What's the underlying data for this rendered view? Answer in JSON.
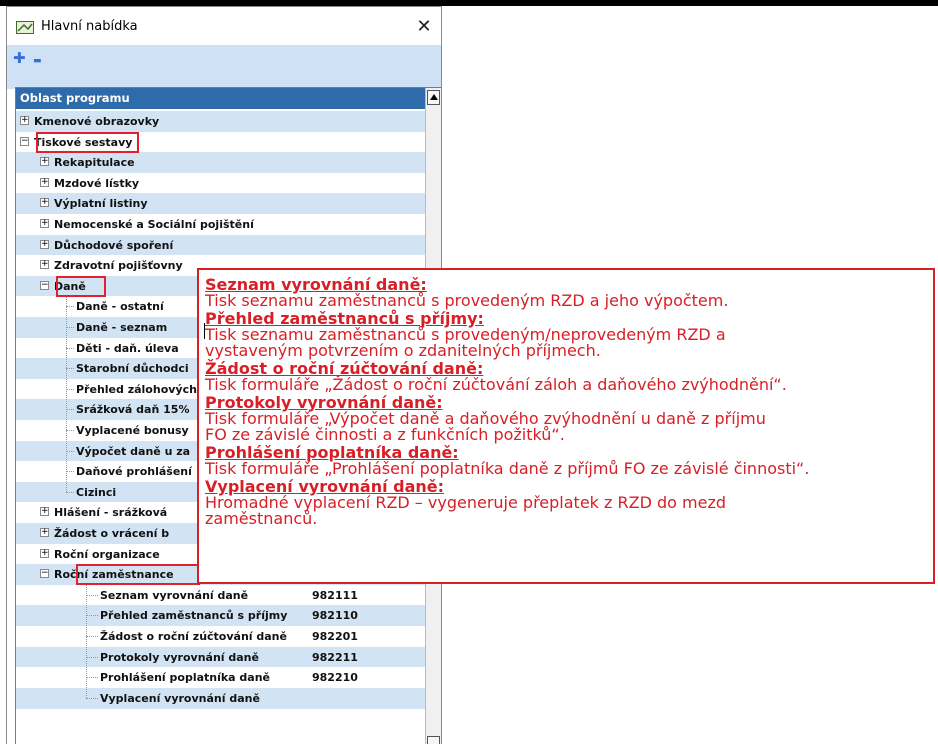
{
  "window": {
    "title": "Hlavní nabídka",
    "close_glyph": "✕",
    "toolbar": {
      "add_glyph": "✚",
      "remove_glyph": "▬"
    }
  },
  "tree": {
    "column_header": "Oblast programu",
    "rows": [
      {
        "label": "Kmenové obrazovky",
        "expander": "+"
      },
      {
        "label": "Tiskové sestavy",
        "expander": "−"
      },
      {
        "label": "Rekapitulace",
        "expander": "+"
      },
      {
        "label": "Mzdové lístky",
        "expander": "+"
      },
      {
        "label": "Výplatní listiny",
        "expander": "+"
      },
      {
        "label": "Nemocenské a Sociální pojištění",
        "expander": "+"
      },
      {
        "label": "Důchodové spoření",
        "expander": "+"
      },
      {
        "label": "Zdravotní pojišťovny",
        "expander": "+"
      },
      {
        "label": "Daně",
        "expander": "−"
      },
      {
        "label": "Daně - ostatní"
      },
      {
        "label": "Daně - seznam"
      },
      {
        "label": "Děti - daň. úleva"
      },
      {
        "label": "Starobní důchodci"
      },
      {
        "label": "Přehled zálohových"
      },
      {
        "label": "Srážková daň 15%"
      },
      {
        "label": "Vyplacené bonusy"
      },
      {
        "label": "Výpočet daně u za"
      },
      {
        "label": "Daňové prohlášení"
      },
      {
        "label": "Cizinci"
      },
      {
        "label": "Hlášení - srážková",
        "expander": "+"
      },
      {
        "label": "Žádost o vrácení b",
        "expander": "+"
      },
      {
        "label": "Roční organizace",
        "expander": "+"
      },
      {
        "label": "Roční zaměstnance",
        "expander": "−"
      },
      {
        "label": "Seznam vyrovnání daně",
        "code": "982111"
      },
      {
        "label": "Přehled zaměstnanců s příjmy",
        "code": "982110"
      },
      {
        "label": "Žádost o roční zúčtování daně",
        "code": "982201"
      },
      {
        "label": "Protokoly vyrovnání daně",
        "code": "982211"
      },
      {
        "label": "Prohlášení poplatníka daně",
        "code": "982210"
      },
      {
        "label": "Vyplacení vyrovnání daně",
        "code": ""
      }
    ]
  },
  "callout": {
    "items": [
      {
        "title": "Seznam vyrovnání daně:",
        "lines": [
          "Tisk seznamu zaměstnanců s provedeným RZD a jeho výpočtem."
        ]
      },
      {
        "title": "Přehled zaměstnanců s příjmy:",
        "lines": [
          "Tisk seznamu zaměstnanců s provedeným/neprovedeným RZD a",
          "vystaveným potvrzením o zdanitelných příjmech."
        ]
      },
      {
        "title": "Žádost o roční zúčtování daně:",
        "lines": [
          "Tisk formuláře „Žádost o roční zúčtování záloh a daňového zvýhodnění“."
        ]
      },
      {
        "title": "Protokoly vyrovnání daně:",
        "lines": [
          "Tisk formuláře „Výpočet daně a daňového zvýhodnění u daně z příjmu",
          "FO ze závislé činnosti a z funkčních požitků“."
        ]
      },
      {
        "title": "Prohlášení poplatníka daně:",
        "lines": [
          "Tisk formuláře „Prohlášení poplatníka daně z příjmů FO ze závislé činnosti“."
        ]
      },
      {
        "title": "Vyplacení vyrovnání daně:",
        "lines": [
          "Hromadné vyplacení RZD – vygeneruje přeplatek z RZD do mezd",
          "zaměstnanců."
        ]
      }
    ]
  },
  "colors": {
    "highlight": "#e0212e",
    "callout_text": "#d81f26",
    "row_alt": "#d2e4f3",
    "header_bg": "#2e6bab"
  }
}
